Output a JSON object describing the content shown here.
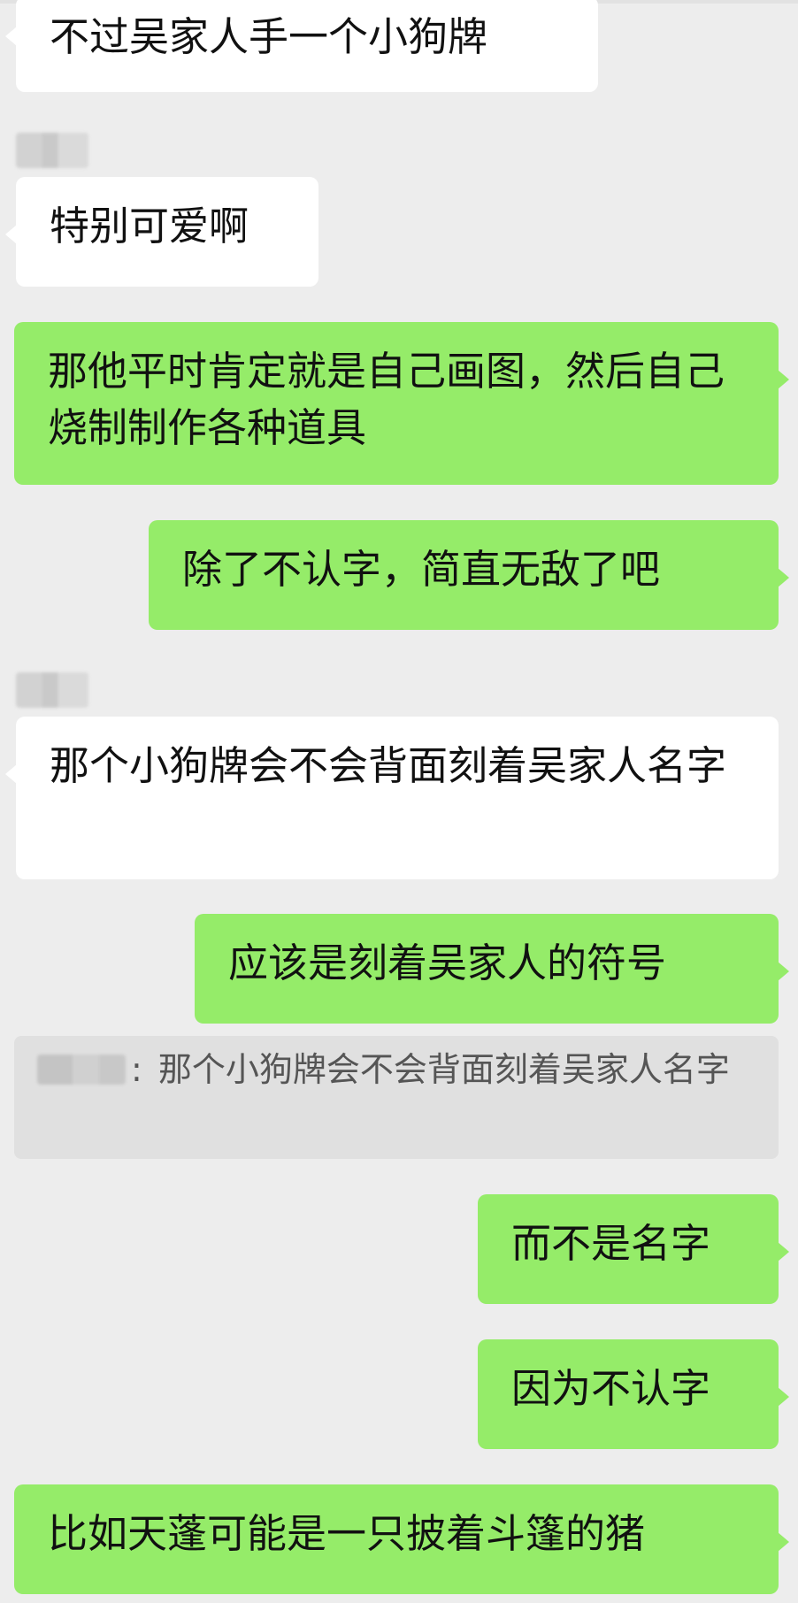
{
  "messages": [
    {
      "side": "in",
      "text": "不过吴家人手一个小狗牌"
    },
    {
      "side": "in",
      "text": "特别可爱啊"
    },
    {
      "side": "out",
      "text": "那他平时肯定就是自己画图，然后自己烧制制作各种道具"
    },
    {
      "side": "out",
      "text": "除了不认字，简直无敌了吧"
    },
    {
      "side": "in",
      "text": "那个小狗牌会不会背面刻着吴家人名字"
    },
    {
      "side": "out",
      "text": "应该是刻着吴家人的符号"
    },
    {
      "side": "out",
      "text": "而不是名字"
    },
    {
      "side": "out",
      "text": "因为不认字"
    },
    {
      "side": "out",
      "text": "比如天蓬可能是一只披着斗篷的猪"
    }
  ],
  "quote": {
    "separator": ":",
    "text": "那个小狗牌会不会背面刻着吴家人名字"
  },
  "colors": {
    "background": "#ededed",
    "incoming_bubble": "#ffffff",
    "outgoing_bubble": "#95ec69",
    "quote_bubble": "#e0e0e0"
  }
}
